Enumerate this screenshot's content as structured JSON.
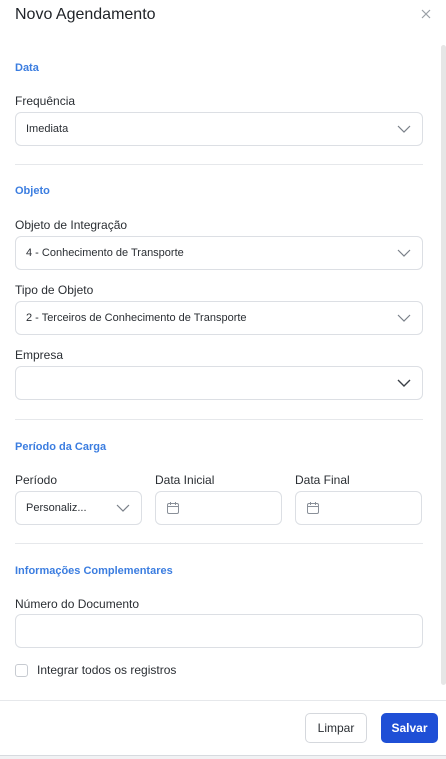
{
  "dialog": {
    "title": "Novo Agendamento",
    "close_icon": "close-icon"
  },
  "sections": {
    "data": {
      "title": "Data",
      "frequencia_label": "Frequência",
      "frequencia_value": "Imediata"
    },
    "objeto": {
      "title": "Objeto",
      "objeto_integracao_label": "Objeto de Integração",
      "objeto_integracao_value": "4 - Conhecimento de Transporte",
      "tipo_objeto_label": "Tipo de Objeto",
      "tipo_objeto_value": "2 - Terceiros de Conhecimento de Transporte",
      "empresa_label": "Empresa",
      "empresa_value": ""
    },
    "periodo": {
      "title": "Período da Carga",
      "periodo_label": "Período",
      "periodo_value": "Personaliz...",
      "data_inicial_label": "Data Inicial",
      "data_final_label": "Data Final"
    },
    "info": {
      "title": "Informações Complementares",
      "numero_documento_label": "Número do Documento",
      "numero_documento_value": "",
      "integrar_label": "Integrar todos os registros",
      "integrar_checked": false
    }
  },
  "footer": {
    "clear_label": "Limpar",
    "save_label": "Salvar"
  },
  "colors": {
    "accent": "#3b7de0",
    "primary_button": "#1f4fd6",
    "border": "#dcdfe4"
  }
}
